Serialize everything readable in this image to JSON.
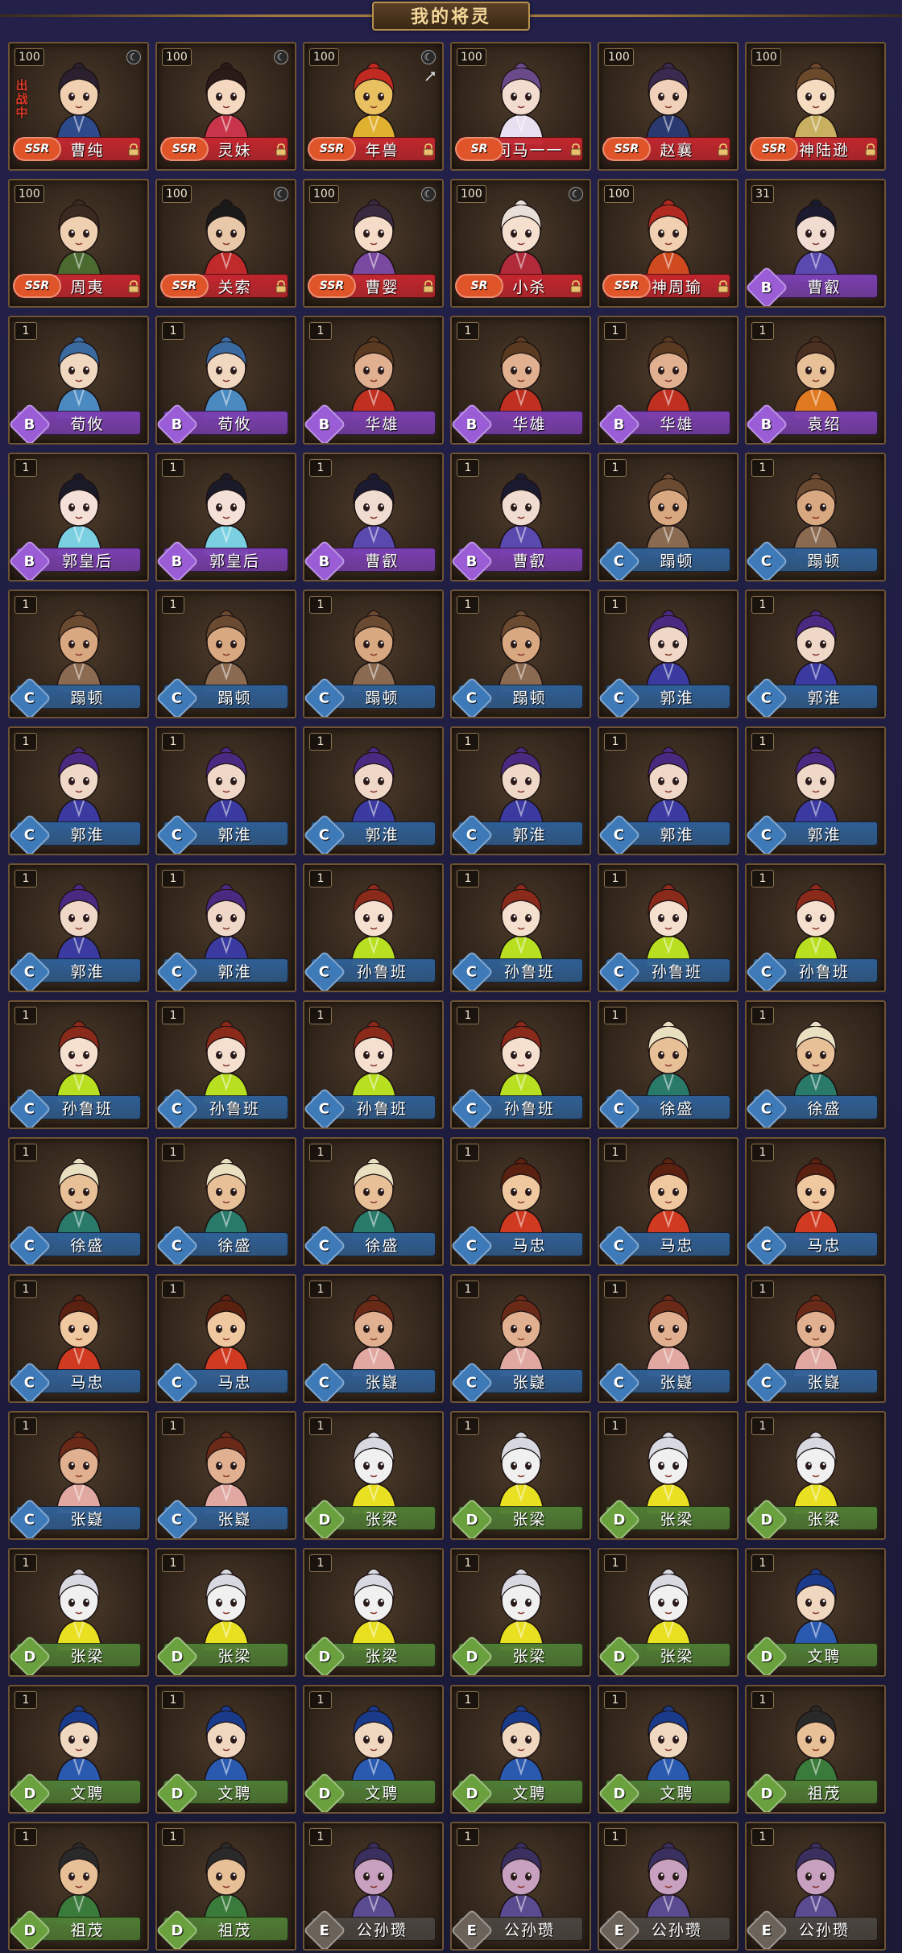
{
  "header": {
    "title": "我的将灵"
  },
  "icons": {
    "star": "star-level-icon",
    "lock": "lock-icon",
    "swap": "swap-icon"
  },
  "grade_colors": {
    "SSR": "#c2262e",
    "SR": "#c2262e",
    "B": "#7a3fb0",
    "C": "#2f5f95",
    "D": "#4f7d35",
    "E": "#4a4540"
  },
  "grade_badge_colors": {
    "SSR": "#e0542a",
    "SR": "#e0542a",
    "B": "#9a5dd6",
    "C": "#3f7ab8",
    "D": "#6aa03e",
    "E": "#6b635a"
  },
  "cards": [
    {
      "level": "100",
      "name": "曹纯",
      "grade": "SSR",
      "grade_label": "SSR",
      "tag": "出战中",
      "star": true,
      "lock": true,
      "skin": "#f0d0b0",
      "hair": "#2a2030",
      "outfit": "#2d4a8a"
    },
    {
      "level": "100",
      "name": "灵妹",
      "grade": "SSR",
      "grade_label": "SSR",
      "star": true,
      "lock": true,
      "skin": "#f5d8c0",
      "hair": "#2a1a18",
      "outfit": "#c8344a"
    },
    {
      "level": "100",
      "name": "年兽",
      "grade": "SSR",
      "grade_label": "SSR",
      "star": true,
      "lock": true,
      "swap": true,
      "skin": "#e8c060",
      "hair": "#c02a20",
      "outfit": "#e0b030"
    },
    {
      "level": "100",
      "name": "司马一一",
      "grade": "SR",
      "grade_label": "SR",
      "lock": true,
      "skin": "#f2dcd0",
      "hair": "#6a4a8a",
      "outfit": "#e8e0f0"
    },
    {
      "level": "100",
      "name": "赵襄",
      "grade": "SSR",
      "grade_label": "SSR",
      "lock": true,
      "skin": "#f0d0b8",
      "hair": "#3a2a50",
      "outfit": "#2a3a70"
    },
    {
      "level": "100",
      "name": "神陆逊",
      "grade": "SSR",
      "grade_label": "SSR",
      "lock": true,
      "skin": "#f5dcc0",
      "hair": "#6a4a2a",
      "outfit": "#c8b060"
    },
    {
      "level": "100",
      "name": "周夷",
      "grade": "SSR",
      "grade_label": "SSR",
      "lock": true,
      "skin": "#efd0b0",
      "hair": "#3a2a20",
      "outfit": "#4a6a30"
    },
    {
      "level": "100",
      "name": "关索",
      "grade": "SSR",
      "grade_label": "SSR",
      "star": true,
      "lock": true,
      "skin": "#e8c8a8",
      "hair": "#1a1a1a",
      "outfit": "#c02a2a"
    },
    {
      "level": "100",
      "name": "曹婴",
      "grade": "SSR",
      "grade_label": "SSR",
      "star": true,
      "lock": true,
      "skin": "#f5dcc8",
      "hair": "#3a2a40",
      "outfit": "#7a4aa0"
    },
    {
      "level": "100",
      "name": "小杀",
      "grade": "SR",
      "grade_label": "SR",
      "star": true,
      "lock": true,
      "skin": "#f5e0d0",
      "hair": "#e8e0d8",
      "outfit": "#b02a3a"
    },
    {
      "level": "100",
      "name": "神周瑜",
      "grade": "SSR",
      "grade_label": "SSR",
      "lock": true,
      "skin": "#f0d0b0",
      "hair": "#b02a20",
      "outfit": "#d04a20"
    },
    {
      "level": "31",
      "name": "曹叡",
      "grade": "B",
      "grade_label": "B",
      "skin": "#f0dcd0",
      "hair": "#1a1a30",
      "outfit": "#5a4ab0"
    },
    {
      "level": "1",
      "name": "荀攸",
      "grade": "B",
      "grade_label": "B",
      "skin": "#f0d8c0",
      "hair": "#3a6aa0",
      "outfit": "#4a8ac0"
    },
    {
      "level": "1",
      "name": "荀攸",
      "grade": "B",
      "grade_label": "B",
      "skin": "#f0d8c0",
      "hair": "#3a6aa0",
      "outfit": "#4a8ac0"
    },
    {
      "level": "1",
      "name": "华雄",
      "grade": "B",
      "grade_label": "B",
      "skin": "#e0b090",
      "hair": "#5a3a20",
      "outfit": "#c03020"
    },
    {
      "level": "1",
      "name": "华雄",
      "grade": "B",
      "grade_label": "B",
      "skin": "#e0b090",
      "hair": "#5a3a20",
      "outfit": "#c03020"
    },
    {
      "level": "1",
      "name": "华雄",
      "grade": "B",
      "grade_label": "B",
      "skin": "#e0b090",
      "hair": "#5a3a20",
      "outfit": "#c03020"
    },
    {
      "level": "1",
      "name": "袁绍",
      "grade": "B",
      "grade_label": "B",
      "skin": "#e8c098",
      "hair": "#4a3020",
      "outfit": "#e07a20"
    },
    {
      "level": "1",
      "name": "郭皇后",
      "grade": "B",
      "grade_label": "B",
      "skin": "#f5e0d8",
      "hair": "#1a1a28",
      "outfit": "#7ad0e0"
    },
    {
      "level": "1",
      "name": "郭皇后",
      "grade": "B",
      "grade_label": "B",
      "skin": "#f5e0d8",
      "hair": "#1a1a28",
      "outfit": "#7ad0e0"
    },
    {
      "level": "1",
      "name": "曹叡",
      "grade": "B",
      "grade_label": "B",
      "skin": "#f0dcd0",
      "hair": "#1a1a30",
      "outfit": "#5a4ab0"
    },
    {
      "level": "1",
      "name": "曹叡",
      "grade": "B",
      "grade_label": "B",
      "skin": "#f0dcd0",
      "hair": "#1a1a30",
      "outfit": "#5a4ab0"
    },
    {
      "level": "1",
      "name": "蹋顿",
      "grade": "C",
      "grade_label": "C",
      "skin": "#d8a880",
      "hair": "#6a4a30",
      "outfit": "#8a6a50"
    },
    {
      "level": "1",
      "name": "蹋顿",
      "grade": "C",
      "grade_label": "C",
      "skin": "#d8a880",
      "hair": "#6a4a30",
      "outfit": "#8a6a50"
    },
    {
      "level": "1",
      "name": "蹋顿",
      "grade": "C",
      "grade_label": "C",
      "skin": "#d8a880",
      "hair": "#6a4a30",
      "outfit": "#8a6a50"
    },
    {
      "level": "1",
      "name": "蹋顿",
      "grade": "C",
      "grade_label": "C",
      "skin": "#d8a880",
      "hair": "#6a4a30",
      "outfit": "#8a6a50"
    },
    {
      "level": "1",
      "name": "蹋顿",
      "grade": "C",
      "grade_label": "C",
      "skin": "#d8a880",
      "hair": "#6a4a30",
      "outfit": "#8a6a50"
    },
    {
      "level": "1",
      "name": "蹋顿",
      "grade": "C",
      "grade_label": "C",
      "skin": "#d8a880",
      "hair": "#6a4a30",
      "outfit": "#8a6a50"
    },
    {
      "level": "1",
      "name": "郭淮",
      "grade": "C",
      "grade_label": "C",
      "skin": "#f0d8c8",
      "hair": "#4a2a80",
      "outfit": "#3a3aa0"
    },
    {
      "level": "1",
      "name": "郭淮",
      "grade": "C",
      "grade_label": "C",
      "skin": "#f0d8c8",
      "hair": "#4a2a80",
      "outfit": "#3a3aa0"
    },
    {
      "level": "1",
      "name": "郭淮",
      "grade": "C",
      "grade_label": "C",
      "skin": "#f0d8c8",
      "hair": "#4a2a80",
      "outfit": "#3a3aa0"
    },
    {
      "level": "1",
      "name": "郭淮",
      "grade": "C",
      "grade_label": "C",
      "skin": "#f0d8c8",
      "hair": "#4a2a80",
      "outfit": "#3a3aa0"
    },
    {
      "level": "1",
      "name": "郭淮",
      "grade": "C",
      "grade_label": "C",
      "skin": "#f0d8c8",
      "hair": "#4a2a80",
      "outfit": "#3a3aa0"
    },
    {
      "level": "1",
      "name": "郭淮",
      "grade": "C",
      "grade_label": "C",
      "skin": "#f0d8c8",
      "hair": "#4a2a80",
      "outfit": "#3a3aa0"
    },
    {
      "level": "1",
      "name": "郭淮",
      "grade": "C",
      "grade_label": "C",
      "skin": "#f0d8c8",
      "hair": "#4a2a80",
      "outfit": "#3a3aa0"
    },
    {
      "level": "1",
      "name": "郭淮",
      "grade": "C",
      "grade_label": "C",
      "skin": "#f0d8c8",
      "hair": "#4a2a80",
      "outfit": "#3a3aa0"
    },
    {
      "level": "1",
      "name": "郭淮",
      "grade": "C",
      "grade_label": "C",
      "skin": "#f0d8c8",
      "hair": "#4a2a80",
      "outfit": "#3a3aa0"
    },
    {
      "level": "1",
      "name": "郭淮",
      "grade": "C",
      "grade_label": "C",
      "skin": "#f0d8c8",
      "hair": "#4a2a80",
      "outfit": "#3a3aa0"
    },
    {
      "level": "1",
      "name": "孙鲁班",
      "grade": "C",
      "grade_label": "C",
      "skin": "#f5e0d0",
      "hair": "#8a2a1a",
      "outfit": "#b8e020"
    },
    {
      "level": "1",
      "name": "孙鲁班",
      "grade": "C",
      "grade_label": "C",
      "skin": "#f5e0d0",
      "hair": "#8a2a1a",
      "outfit": "#b8e020"
    },
    {
      "level": "1",
      "name": "孙鲁班",
      "grade": "C",
      "grade_label": "C",
      "skin": "#f5e0d0",
      "hair": "#8a2a1a",
      "outfit": "#b8e020"
    },
    {
      "level": "1",
      "name": "孙鲁班",
      "grade": "C",
      "grade_label": "C",
      "skin": "#f5e0d0",
      "hair": "#8a2a1a",
      "outfit": "#b8e020"
    },
    {
      "level": "1",
      "name": "孙鲁班",
      "grade": "C",
      "grade_label": "C",
      "skin": "#f5e0d0",
      "hair": "#8a2a1a",
      "outfit": "#b8e020"
    },
    {
      "level": "1",
      "name": "孙鲁班",
      "grade": "C",
      "grade_label": "C",
      "skin": "#f5e0d0",
      "hair": "#8a2a1a",
      "outfit": "#b8e020"
    },
    {
      "level": "1",
      "name": "孙鲁班",
      "grade": "C",
      "grade_label": "C",
      "skin": "#f5e0d0",
      "hair": "#8a2a1a",
      "outfit": "#b8e020"
    },
    {
      "level": "1",
      "name": "孙鲁班",
      "grade": "C",
      "grade_label": "C",
      "skin": "#f5e0d0",
      "hair": "#8a2a1a",
      "outfit": "#b8e020"
    },
    {
      "level": "1",
      "name": "徐盛",
      "grade": "C",
      "grade_label": "C",
      "skin": "#e8c098",
      "hair": "#e8e0c0",
      "outfit": "#2a7a6a"
    },
    {
      "level": "1",
      "name": "徐盛",
      "grade": "C",
      "grade_label": "C",
      "skin": "#e8c098",
      "hair": "#e8e0c0",
      "outfit": "#2a7a6a"
    },
    {
      "level": "1",
      "name": "徐盛",
      "grade": "C",
      "grade_label": "C",
      "skin": "#e8c098",
      "hair": "#e8e0c0",
      "outfit": "#2a7a6a"
    },
    {
      "level": "1",
      "name": "徐盛",
      "grade": "C",
      "grade_label": "C",
      "skin": "#e8c098",
      "hair": "#e8e0c0",
      "outfit": "#2a7a6a"
    },
    {
      "level": "1",
      "name": "徐盛",
      "grade": "C",
      "grade_label": "C",
      "skin": "#e8c098",
      "hair": "#e8e0c0",
      "outfit": "#2a7a6a"
    },
    {
      "level": "1",
      "name": "马忠",
      "grade": "C",
      "grade_label": "C",
      "skin": "#f0c8a0",
      "hair": "#5a2010",
      "outfit": "#d03a20"
    },
    {
      "level": "1",
      "name": "马忠",
      "grade": "C",
      "grade_label": "C",
      "skin": "#f0c8a0",
      "hair": "#5a2010",
      "outfit": "#d03a20"
    },
    {
      "level": "1",
      "name": "马忠",
      "grade": "C",
      "grade_label": "C",
      "skin": "#f0c8a0",
      "hair": "#5a2010",
      "outfit": "#d03a20"
    },
    {
      "level": "1",
      "name": "马忠",
      "grade": "C",
      "grade_label": "C",
      "skin": "#f0c8a0",
      "hair": "#5a2010",
      "outfit": "#d03a20"
    },
    {
      "level": "1",
      "name": "马忠",
      "grade": "C",
      "grade_label": "C",
      "skin": "#f0c8a0",
      "hair": "#5a2010",
      "outfit": "#d03a20"
    },
    {
      "level": "1",
      "name": "张嶷",
      "grade": "C",
      "grade_label": "C",
      "skin": "#e0b090",
      "hair": "#6a2a18",
      "outfit": "#e0a8a0"
    },
    {
      "level": "1",
      "name": "张嶷",
      "grade": "C",
      "grade_label": "C",
      "skin": "#e0b090",
      "hair": "#6a2a18",
      "outfit": "#e0a8a0"
    },
    {
      "level": "1",
      "name": "张嶷",
      "grade": "C",
      "grade_label": "C",
      "skin": "#e0b090",
      "hair": "#6a2a18",
      "outfit": "#e0a8a0"
    },
    {
      "level": "1",
      "name": "张嶷",
      "grade": "C",
      "grade_label": "C",
      "skin": "#e0b090",
      "hair": "#6a2a18",
      "outfit": "#e0a8a0"
    },
    {
      "level": "1",
      "name": "张嶷",
      "grade": "C",
      "grade_label": "C",
      "skin": "#e0b090",
      "hair": "#6a2a18",
      "outfit": "#e0a8a0"
    },
    {
      "level": "1",
      "name": "张嶷",
      "grade": "C",
      "grade_label": "C",
      "skin": "#e0b090",
      "hair": "#6a2a18",
      "outfit": "#e0a8a0"
    },
    {
      "level": "1",
      "name": "张梁",
      "grade": "D",
      "grade_label": "D",
      "skin": "#f0f0f0",
      "hair": "#d8d8e0",
      "outfit": "#e8e020"
    },
    {
      "level": "1",
      "name": "张梁",
      "grade": "D",
      "grade_label": "D",
      "skin": "#f0f0f0",
      "hair": "#d8d8e0",
      "outfit": "#e8e020"
    },
    {
      "level": "1",
      "name": "张梁",
      "grade": "D",
      "grade_label": "D",
      "skin": "#f0f0f0",
      "hair": "#d8d8e0",
      "outfit": "#e8e020"
    },
    {
      "level": "1",
      "name": "张梁",
      "grade": "D",
      "grade_label": "D",
      "skin": "#f0f0f0",
      "hair": "#d8d8e0",
      "outfit": "#e8e020"
    },
    {
      "level": "1",
      "name": "张梁",
      "grade": "D",
      "grade_label": "D",
      "skin": "#f0f0f0",
      "hair": "#d8d8e0",
      "outfit": "#e8e020"
    },
    {
      "level": "1",
      "name": "张梁",
      "grade": "D",
      "grade_label": "D",
      "skin": "#f0f0f0",
      "hair": "#d8d8e0",
      "outfit": "#e8e020"
    },
    {
      "level": "1",
      "name": "张梁",
      "grade": "D",
      "grade_label": "D",
      "skin": "#f0f0f0",
      "hair": "#d8d8e0",
      "outfit": "#e8e020"
    },
    {
      "level": "1",
      "name": "张梁",
      "grade": "D",
      "grade_label": "D",
      "skin": "#f0f0f0",
      "hair": "#d8d8e0",
      "outfit": "#e8e020"
    },
    {
      "level": "1",
      "name": "张梁",
      "grade": "D",
      "grade_label": "D",
      "skin": "#f0f0f0",
      "hair": "#d8d8e0",
      "outfit": "#e8e020"
    },
    {
      "level": "1",
      "name": "文聘",
      "grade": "D",
      "grade_label": "D",
      "skin": "#f0d8c0",
      "hair": "#1a3a8a",
      "outfit": "#2a5ab0"
    },
    {
      "level": "1",
      "name": "文聘",
      "grade": "D",
      "grade_label": "D",
      "skin": "#f0d8c0",
      "hair": "#1a3a8a",
      "outfit": "#2a5ab0"
    },
    {
      "level": "1",
      "name": "文聘",
      "grade": "D",
      "grade_label": "D",
      "skin": "#f0d8c0",
      "hair": "#1a3a8a",
      "outfit": "#2a5ab0"
    },
    {
      "level": "1",
      "name": "文聘",
      "grade": "D",
      "grade_label": "D",
      "skin": "#f0d8c0",
      "hair": "#1a3a8a",
      "outfit": "#2a5ab0"
    },
    {
      "level": "1",
      "name": "文聘",
      "grade": "D",
      "grade_label": "D",
      "skin": "#f0d8c0",
      "hair": "#1a3a8a",
      "outfit": "#2a5ab0"
    },
    {
      "level": "1",
      "name": "文聘",
      "grade": "D",
      "grade_label": "D",
      "skin": "#f0d8c0",
      "hair": "#1a3a8a",
      "outfit": "#2a5ab0"
    },
    {
      "level": "1",
      "name": "祖茂",
      "grade": "D",
      "grade_label": "D",
      "skin": "#e8c098",
      "hair": "#2a2a2a",
      "outfit": "#3a7a3a"
    },
    {
      "level": "1",
      "name": "祖茂",
      "grade": "D",
      "grade_label": "D",
      "skin": "#e8c098",
      "hair": "#2a2a2a",
      "outfit": "#3a7a3a"
    },
    {
      "level": "1",
      "name": "祖茂",
      "grade": "D",
      "grade_label": "D",
      "skin": "#e8c098",
      "hair": "#2a2a2a",
      "outfit": "#3a7a3a"
    },
    {
      "level": "1",
      "name": "公孙瓒",
      "grade": "E",
      "grade_label": "E",
      "skin": "#c8a0c0",
      "hair": "#3a3060",
      "outfit": "#5a4a90"
    },
    {
      "level": "1",
      "name": "公孙瓒",
      "grade": "E",
      "grade_label": "E",
      "skin": "#c8a0c0",
      "hair": "#3a3060",
      "outfit": "#5a4a90"
    },
    {
      "level": "1",
      "name": "公孙瓒",
      "grade": "E",
      "grade_label": "E",
      "skin": "#c8a0c0",
      "hair": "#3a3060",
      "outfit": "#5a4a90"
    },
    {
      "level": "1",
      "name": "公孙瓒",
      "grade": "E",
      "grade_label": "E",
      "skin": "#c8a0c0",
      "hair": "#3a3060",
      "outfit": "#5a4a90"
    }
  ]
}
